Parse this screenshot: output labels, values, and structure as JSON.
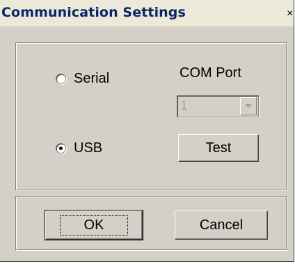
{
  "window": {
    "title": "Communication Settings",
    "close_glyph": "×"
  },
  "connection": {
    "serial_label": "Serial",
    "serial_checked": false,
    "usb_label": "USB",
    "usb_checked": true
  },
  "com_port": {
    "label": "COM Port",
    "value": "1",
    "enabled": false
  },
  "buttons": {
    "test": "Test",
    "ok": "OK",
    "cancel": "Cancel"
  },
  "icons": {
    "close": "close-icon",
    "dropdown": "chevron-down-icon"
  },
  "colors": {
    "dialog_bg": "#d4d0c8",
    "title_text": "#0a246a",
    "disabled_text": "#a0a0a0"
  }
}
